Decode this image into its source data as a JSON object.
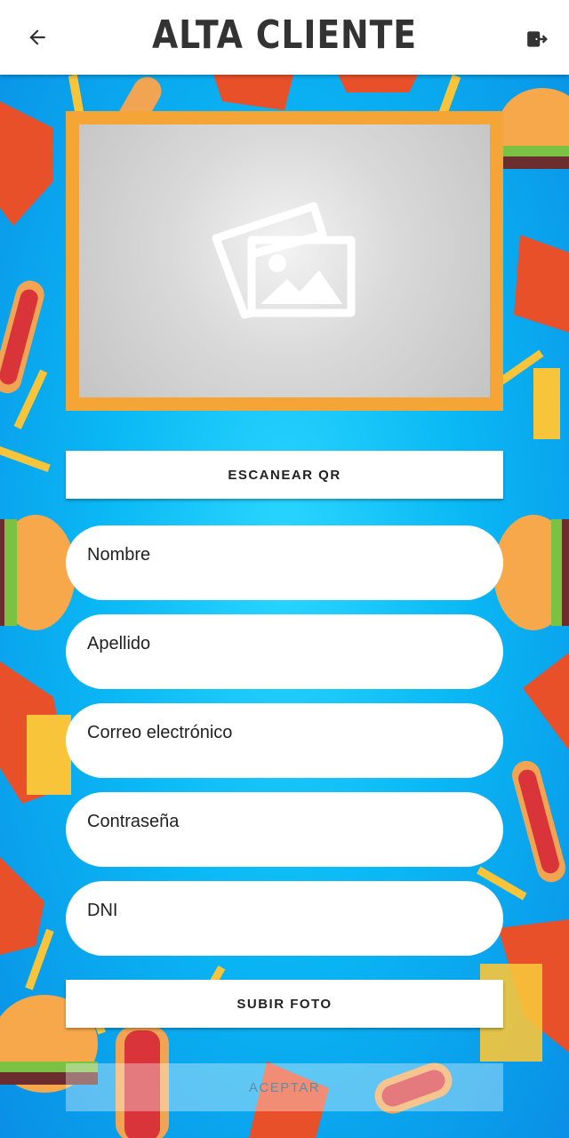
{
  "header": {
    "title": "ALTA CLIENTE",
    "back_icon": "arrow-left-icon",
    "logout_icon": "logout-icon"
  },
  "photo": {
    "icon": "image-placeholder-icon",
    "frame_color": "#f5a535"
  },
  "buttons": {
    "scan_qr": "ESCANEAR QR",
    "upload_photo": "SUBIR FOTO",
    "accept": "ACEPTAR"
  },
  "form": {
    "name_placeholder": "Nombre",
    "surname_placeholder": "Apellido",
    "email_placeholder": "Correo electrónico",
    "password_placeholder": "Contraseña",
    "dni_placeholder": "DNI"
  },
  "colors": {
    "background": "#0ab8f4",
    "accent": "#f5a535"
  }
}
